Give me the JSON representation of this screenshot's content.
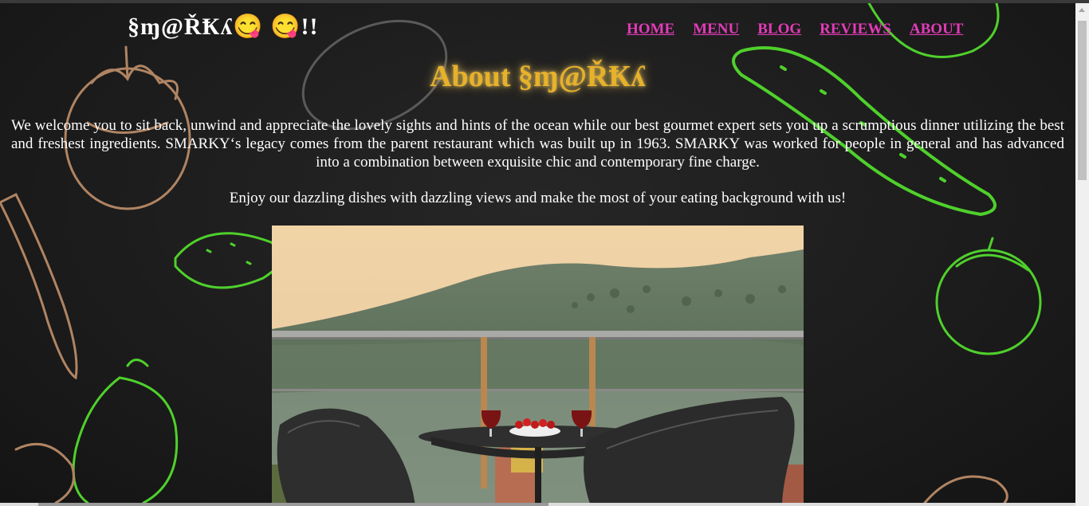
{
  "logo": {
    "text": "§ɱ@ŘҞʎ😋 😋!!"
  },
  "nav": {
    "items": [
      "HOME",
      "MENU",
      "BLOG",
      "REVIEWS",
      "ABOUT"
    ]
  },
  "about": {
    "title": "About §ɱ@ŘҞʎ",
    "paragraph1": "We welcome you to sit back, unwind and appreciate the lovely sights and hints of the ocean while our best gourmet expert sets you up a scrumptious dinner utilizing the best and freshest ingredients. SMARKY‘s legacy comes from the parent restaurant which was built up in 1963. SMARKY was worked for people in general and has advanced into a combination between exquisite chic and contemporary fine charge.",
    "paragraph2": "Enjoy our dazzling dishes with dazzling views and make the most of your eating background with us!"
  },
  "colors": {
    "nav_link": "#e23bb8",
    "title": "#e7b12a",
    "background": "#1b1b1b",
    "text": "#ffffff"
  },
  "background_art": {
    "icons": [
      "tomato-sketch",
      "cucumber-sketch",
      "knife-sketch",
      "eggplant-sketch",
      "potato-sketch"
    ]
  },
  "photo": {
    "subject": "balcony-dining-table-with-wine-and-strawberries"
  }
}
